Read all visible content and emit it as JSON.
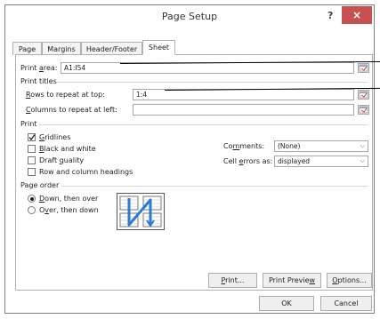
{
  "dialog": {
    "title": "Page Setup",
    "help": "?",
    "close": "×"
  },
  "tabs": [
    {
      "label": "Page"
    },
    {
      "label": "Margins"
    },
    {
      "label": "Header/Footer"
    },
    {
      "label": "Sheet"
    }
  ],
  "print_area": {
    "label_pre": "Print ",
    "label_u": "a",
    "label_post": "rea:",
    "value": "A1:I54"
  },
  "print_titles": {
    "section": "Print titles",
    "rows": {
      "label_u": "R",
      "label_post": "ows to repeat at top:",
      "value": "1:4"
    },
    "columns": {
      "label_u": "C",
      "label_post": "olumns to repeat at left:",
      "value": ""
    }
  },
  "print": {
    "section": "Print",
    "options": [
      {
        "pre": "",
        "u": "G",
        "post": "ridlines",
        "checked": true
      },
      {
        "pre": "",
        "u": "B",
        "post": "lack and white",
        "checked": false
      },
      {
        "pre": "Draft ",
        "u": "q",
        "post": "uality",
        "checked": false
      },
      {
        "pre": "Row and column headings",
        "u": "",
        "post": "",
        "checked": false
      }
    ],
    "comments": {
      "label_pre": "Co",
      "label_u": "m",
      "label_post": "ments:",
      "value": "(None)"
    },
    "cell_errors": {
      "label_pre": "Cell ",
      "label_u": "e",
      "label_post": "rrors as:",
      "value": "displayed"
    }
  },
  "page_order": {
    "section": "Page order",
    "options": [
      {
        "pre": "",
        "u": "D",
        "post": "own, then over",
        "selected": true
      },
      {
        "pre": "O",
        "u": "v",
        "post": "er, then down",
        "selected": false
      }
    ]
  },
  "buttons": {
    "print": {
      "u": "P",
      "post": "rint..."
    },
    "preview": {
      "pre": "Print Previe",
      "u": "w",
      "post": ""
    },
    "options": {
      "u": "O",
      "post": "ptions..."
    },
    "ok": "OK",
    "cancel": "Cancel"
  },
  "colors": {
    "close_bg": "#c75050",
    "border": "#b0b0b0",
    "accent": "#2a7bd5"
  },
  "icons": [
    "close-icon",
    "range-select-icon",
    "page-order-preview-icon",
    "dropdown-arrow-icon"
  ]
}
